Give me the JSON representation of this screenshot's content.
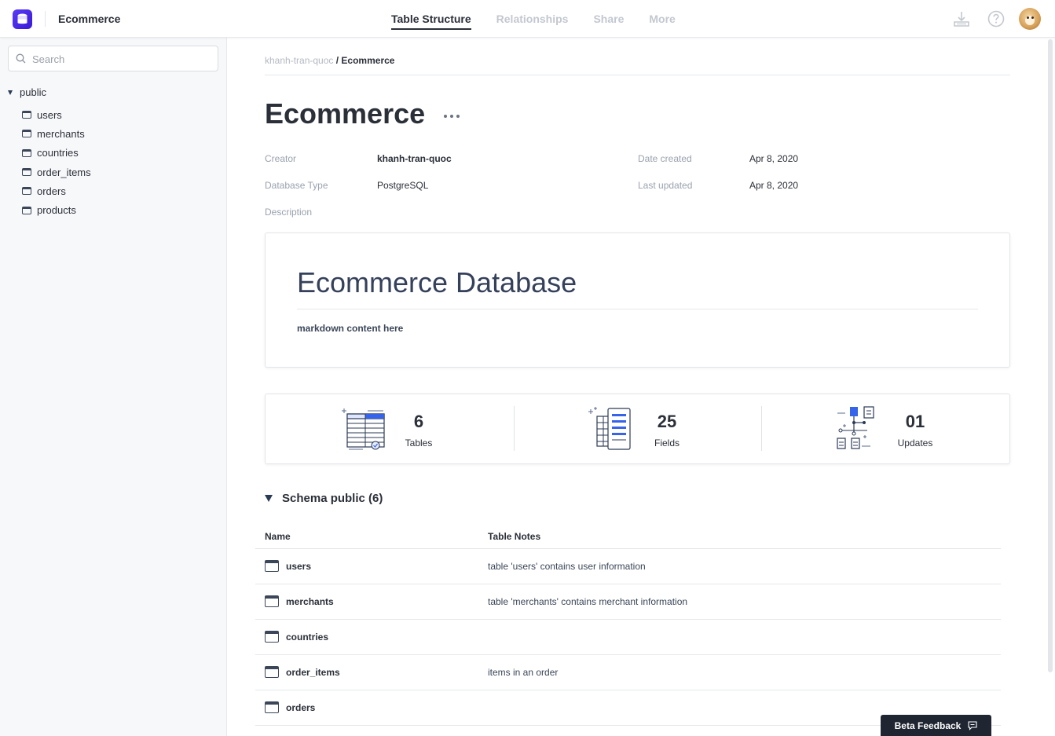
{
  "app": {
    "title": "Ecommerce"
  },
  "nav": {
    "tabs": [
      {
        "label": "Table Structure",
        "active": true
      },
      {
        "label": "Relationships",
        "active": false
      },
      {
        "label": "Share",
        "active": false
      },
      {
        "label": "More",
        "active": false
      }
    ]
  },
  "header_icons": [
    "download-icon",
    "help-icon",
    "avatar"
  ],
  "sidebar": {
    "search_placeholder": "Search",
    "schema": "public",
    "tables": [
      "users",
      "merchants",
      "countries",
      "order_items",
      "orders",
      "products"
    ]
  },
  "breadcrumb": {
    "owner": "khanh-tran-quoc",
    "separator": "/",
    "current": "Ecommerce"
  },
  "page": {
    "title": "Ecommerce"
  },
  "meta": {
    "creator_label": "Creator",
    "creator": "khanh-tran-quoc",
    "db_type_label": "Database Type",
    "db_type": "PostgreSQL",
    "description_label": "Description",
    "date_created_label": "Date created",
    "date_created": "Apr 8, 2020",
    "last_updated_label": "Last updated",
    "last_updated": "Apr 8, 2020"
  },
  "description": {
    "heading": "Ecommerce Database",
    "body": "markdown content here"
  },
  "stats": [
    {
      "value": "6",
      "label": "Tables",
      "icon": "tables-icon"
    },
    {
      "value": "25",
      "label": "Fields",
      "icon": "fields-icon"
    },
    {
      "value": "01",
      "label": "Updates",
      "icon": "updates-icon"
    }
  ],
  "schema_section": {
    "title": "Schema public (6)",
    "columns": [
      "Name",
      "Table Notes"
    ],
    "rows": [
      {
        "name": "users",
        "note": "table 'users' contains user information"
      },
      {
        "name": "merchants",
        "note": "table 'merchants' contains merchant information"
      },
      {
        "name": "countries",
        "note": ""
      },
      {
        "name": "order_items",
        "note": "items in an order"
      },
      {
        "name": "orders",
        "note": ""
      }
    ]
  },
  "feedback": {
    "label": "Beta Feedback"
  },
  "colors": {
    "brand": "#4a25e8",
    "text": "#2b2f38",
    "muted": "#9aa2ae",
    "sidebar_bg": "#f7f8fa",
    "feedback_bg": "#1f2631"
  }
}
